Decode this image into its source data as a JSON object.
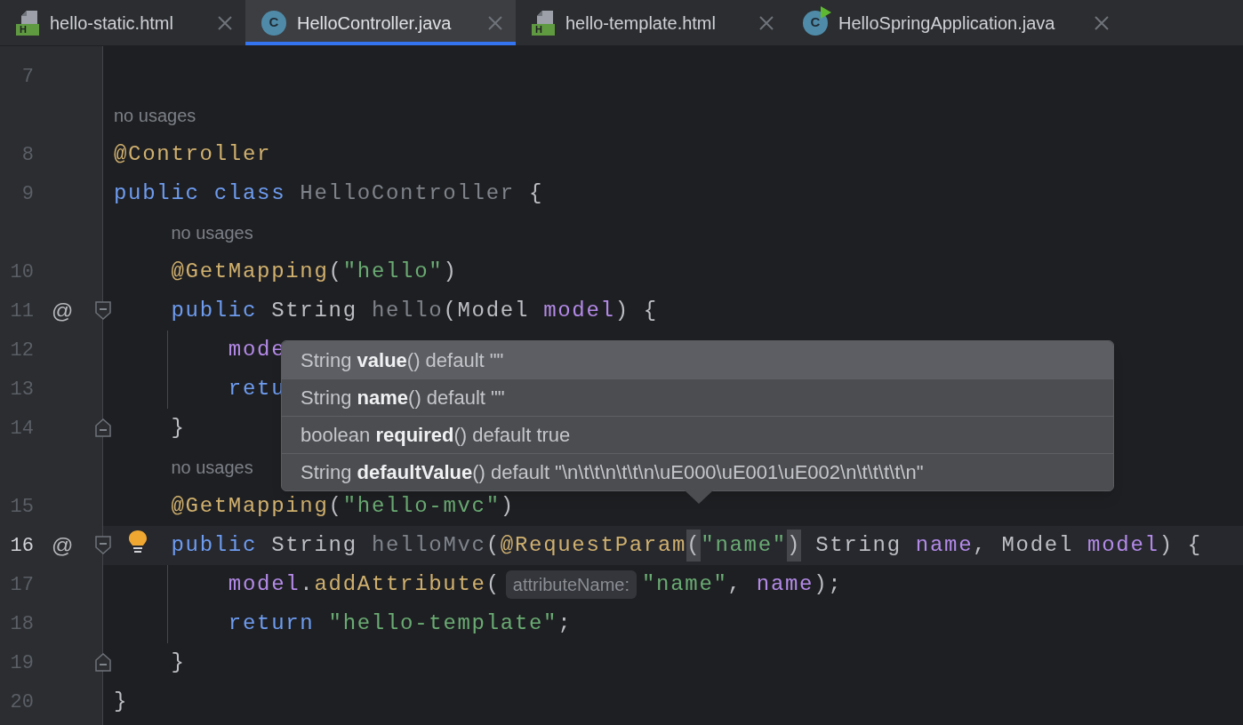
{
  "tabs": [
    {
      "label": "hello-static.html",
      "kind": "html",
      "icon_letter": "H",
      "selected": false
    },
    {
      "label": "HelloController.java",
      "kind": "class",
      "icon_letter": "C",
      "selected": true
    },
    {
      "label": "hello-template.html",
      "kind": "html",
      "icon_letter": "H",
      "selected": false
    },
    {
      "label": "HelloSpringApplication.java",
      "kind": "run_class",
      "icon_letter": "C",
      "selected": false
    }
  ],
  "editor": {
    "lines": [
      {
        "kind": "code",
        "number": "7",
        "current": false
      },
      {
        "kind": "hint",
        "text": "no usages"
      },
      {
        "kind": "code",
        "number": "8",
        "current": false,
        "tokens": [
          {
            "text": "@Controller",
            "kind": "annotation"
          }
        ]
      },
      {
        "kind": "code",
        "number": "9",
        "current": false,
        "tokens": [
          {
            "text": "public class ",
            "kind": "keyword"
          },
          {
            "text": "HelloController ",
            "kind": "unused"
          },
          {
            "text": "{",
            "kind": "plain"
          }
        ]
      },
      {
        "kind": "hint",
        "text": "    no usages"
      },
      {
        "kind": "code",
        "number": "10",
        "current": false,
        "tokens": [
          {
            "text": "    @GetMapping",
            "kind": "annotation"
          },
          {
            "text": "(",
            "kind": "plain"
          },
          {
            "text": "\"hello\"",
            "kind": "string"
          },
          {
            "text": ")",
            "kind": "plain"
          }
        ]
      },
      {
        "kind": "code",
        "number": "11",
        "current": false,
        "at_marker": "@",
        "fold_start": true,
        "tokens": [
          {
            "text": "    public ",
            "kind": "keyword"
          },
          {
            "text": "String ",
            "kind": "type"
          },
          {
            "text": "hello",
            "kind": "unused"
          },
          {
            "text": "(Model ",
            "kind": "plain"
          },
          {
            "text": "model",
            "kind": "param"
          },
          {
            "text": ") {",
            "kind": "plain"
          }
        ]
      },
      {
        "kind": "code",
        "number": "12",
        "current": false,
        "guide": true,
        "tokens": [
          {
            "text": "        mode",
            "kind": "param"
          }
        ]
      },
      {
        "kind": "code",
        "number": "13",
        "current": false,
        "guide": true,
        "tokens": [
          {
            "text": "        retu",
            "kind": "keyword"
          }
        ]
      },
      {
        "kind": "code",
        "number": "14",
        "current": false,
        "fold_end": true,
        "tokens": [
          {
            "text": "    }",
            "kind": "plain"
          }
        ]
      },
      {
        "kind": "hint",
        "text": "    no usages"
      },
      {
        "kind": "code",
        "number": "15",
        "current": false,
        "tokens": [
          {
            "text": "    @GetMapping",
            "kind": "annotation"
          },
          {
            "text": "(",
            "kind": "plain"
          },
          {
            "text": "\"hello-mvc\"",
            "kind": "string"
          },
          {
            "text": ")",
            "kind": "plain"
          }
        ]
      },
      {
        "kind": "code",
        "number": "16",
        "current": true,
        "at_marker": "@",
        "fold_start": true,
        "bulb": true,
        "tokens": [
          {
            "text": "    public ",
            "kind": "keyword"
          },
          {
            "text": "String ",
            "kind": "type"
          },
          {
            "text": "helloMvc",
            "kind": "unused"
          },
          {
            "text": "(",
            "kind": "plain"
          },
          {
            "text": "@RequestParam",
            "kind": "annotation"
          },
          {
            "text": "(",
            "kind": "match"
          },
          {
            "text": "\"name\"",
            "kind": "string"
          },
          {
            "text": ")",
            "kind": "match"
          },
          {
            "text": " String ",
            "kind": "type"
          },
          {
            "text": "name",
            "kind": "param"
          },
          {
            "text": ", Model ",
            "kind": "plain"
          },
          {
            "text": "model",
            "kind": "param"
          },
          {
            "text": ") {",
            "kind": "plain"
          }
        ]
      },
      {
        "kind": "code",
        "number": "17",
        "current": false,
        "guide": true,
        "tokens": [
          {
            "text": "        model",
            "kind": "param"
          },
          {
            "text": ".",
            "kind": "plain"
          },
          {
            "text": "addAttribute",
            "kind": "method"
          },
          {
            "text": "(",
            "kind": "plain"
          },
          {
            "text": "attributeName:",
            "kind": "inlay"
          },
          {
            "text": "\"name\"",
            "kind": "string"
          },
          {
            "text": ", ",
            "kind": "plain"
          },
          {
            "text": "name",
            "kind": "param"
          },
          {
            "text": ");",
            "kind": "plain"
          }
        ]
      },
      {
        "kind": "code",
        "number": "18",
        "current": false,
        "guide": true,
        "tokens": [
          {
            "text": "        return ",
            "kind": "keyword"
          },
          {
            "text": "\"hello-template\"",
            "kind": "string"
          },
          {
            "text": ";",
            "kind": "plain"
          }
        ]
      },
      {
        "kind": "code",
        "number": "19",
        "current": false,
        "fold_end": true,
        "tokens": [
          {
            "text": "    }",
            "kind": "plain"
          }
        ]
      },
      {
        "kind": "code",
        "number": "20",
        "current": false,
        "tokens": [
          {
            "text": "}",
            "kind": "plain"
          }
        ]
      }
    ]
  },
  "popup": {
    "items": [
      {
        "text": "String **value**() default \"\"",
        "selected": true
      },
      {
        "text": "String **name**() default \"\"",
        "selected": false
      },
      {
        "text": "boolean **required**() default true",
        "selected": false
      },
      {
        "text": "String **defaultValue**() default \"\\n\\t\\t\\n\\t\\t\\n\\uE000\\uE001\\uE002\\n\\t\\t\\t\\t\\n\"",
        "selected": false
      }
    ]
  }
}
